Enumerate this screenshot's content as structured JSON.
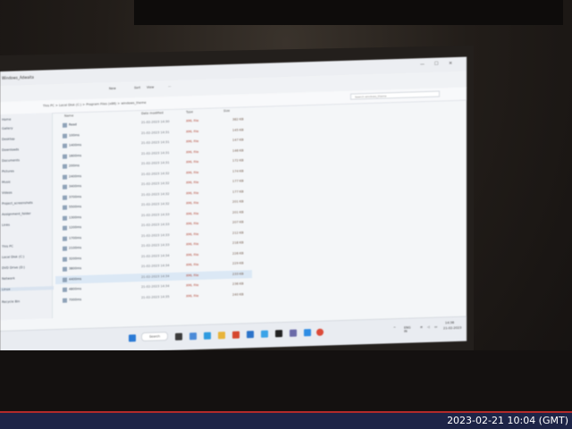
{
  "window": {
    "title": "Windows_Adwaita",
    "controls": [
      "—",
      "☐",
      "✕"
    ]
  },
  "toolbar": {
    "items": [
      "New",
      "Sort",
      "View",
      "···"
    ]
  },
  "address": {
    "path": "This PC  >  Local Disk (C:)  >  Program Files (x86)  >  windows_theme",
    "search_placeholder": "Search windows_theme"
  },
  "sidebar": {
    "items": [
      "Home",
      "Gallery",
      "Desktop",
      "Downloads",
      "Documents",
      "Pictures",
      "Music",
      "Videos",
      "Project_screenshots",
      "Assignment_folder",
      "Links",
      "This PC",
      "Local Disk (C:)",
      "DVD Drive (D:)",
      "Network",
      "Linux",
      "Recycle Bin"
    ]
  },
  "columns": {
    "name": "Name",
    "date": "Date modified",
    "type": "Type",
    "size": "Size"
  },
  "files": [
    {
      "name": "Read",
      "date": "21-02-2023 14:30",
      "type": "XML File",
      "size": "382 KB"
    },
    {
      "name": "100ms",
      "date": "21-02-2023 14:31",
      "type": "XML File",
      "size": "145 KB"
    },
    {
      "name": "1400ms",
      "date": "21-02-2023 14:31",
      "type": "XML File",
      "size": "147 KB"
    },
    {
      "name": "1600ms",
      "date": "21-02-2023 14:31",
      "type": "XML File",
      "size": "146 KB"
    },
    {
      "name": "200ms",
      "date": "21-02-2023 14:31",
      "type": "XML File",
      "size": "172 KB"
    },
    {
      "name": "2400ms",
      "date": "21-02-2023 14:32",
      "type": "XML File",
      "size": "174 KB"
    },
    {
      "name": "3400ms",
      "date": "21-02-2023 14:32",
      "type": "XML File",
      "size": "177 KB"
    },
    {
      "name": "3700ms",
      "date": "21-02-2023 14:32",
      "type": "XML File",
      "size": "177 KB"
    },
    {
      "name": "5500ms",
      "date": "21-02-2023 14:32",
      "type": "XML File",
      "size": "201 KB"
    },
    {
      "name": "1300ms",
      "date": "21-02-2023 14:33",
      "type": "XML File",
      "size": "201 KB"
    },
    {
      "name": "1200ms",
      "date": "21-02-2023 14:33",
      "type": "XML File",
      "size": "207 KB"
    },
    {
      "name": "1700ms",
      "date": "21-02-2023 14:33",
      "type": "XML File",
      "size": "212 KB"
    },
    {
      "name": "2100ms",
      "date": "21-02-2023 14:33",
      "type": "XML File",
      "size": "218 KB"
    },
    {
      "name": "3200ms",
      "date": "21-02-2023 14:34",
      "type": "XML File",
      "size": "226 KB"
    },
    {
      "name": "3800ms",
      "date": "21-02-2023 14:34",
      "type": "XML File",
      "size": "229 KB"
    },
    {
      "name": "4400ms",
      "date": "21-02-2023 14:34",
      "type": "XML File",
      "size": "233 KB"
    },
    {
      "name": "4800ms",
      "date": "21-02-2023 14:34",
      "type": "XML File",
      "size": "236 KB"
    },
    {
      "name": "7000ms",
      "date": "21-02-2023 14:35",
      "type": "XML File",
      "size": "240 KB"
    }
  ],
  "taskbar": {
    "search_label": "Search",
    "tray_lang": "ENG\nIN",
    "tray_time": "14:36",
    "tray_date": "21-02-2023"
  },
  "camera_timestamp": "2023-02-21 10:04 (GMT)",
  "colors": {
    "accent": "#b22a2a",
    "banner": "#1d2447"
  }
}
